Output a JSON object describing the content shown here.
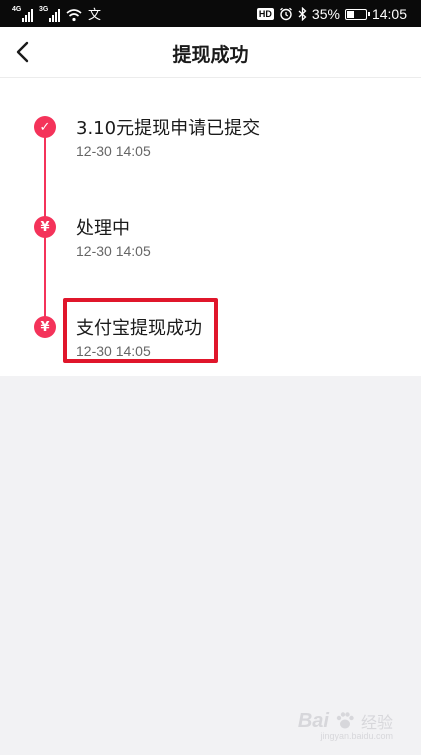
{
  "status_bar": {
    "signal1_label": "4G",
    "signal2_label": "3G",
    "extra_icon_char": "文",
    "hd_label": "HD",
    "battery_percent": "35%",
    "battery_level": 0.35,
    "time": "14:05"
  },
  "nav": {
    "title": "提现成功",
    "back_icon": "chevron-left-icon"
  },
  "timeline": {
    "accent_color": "#f4335a",
    "steps": [
      {
        "title": "3.10元提现申请已提交",
        "time": "12-30 14:05",
        "icon": "check-icon",
        "glyph": "✓"
      },
      {
        "title": "处理中",
        "time": "12-30 14:05",
        "icon": "yuan-icon",
        "glyph": "¥"
      },
      {
        "title": "支付宝提现成功",
        "time": "12-30 14:05",
        "icon": "yuan-icon",
        "glyph": "¥"
      }
    ],
    "highlight_color": "#e0162b"
  },
  "watermark": {
    "logo_text": "Bai",
    "logo_suffix": "经验",
    "sub_text": "jingyan.baidu.com"
  }
}
